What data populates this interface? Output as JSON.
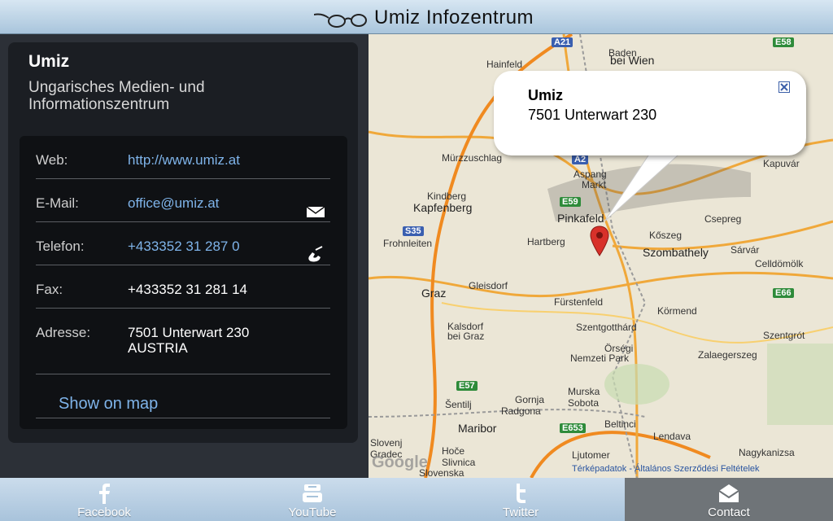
{
  "header": {
    "title": "Umiz  Infozentrum",
    "logo_icon": "glasses-icon"
  },
  "contact": {
    "name": "Umiz",
    "subtitle": "Ungarisches Medien- und Informationszentrum",
    "rows": [
      {
        "label": "Web:",
        "value": "http://www.umiz.at",
        "link": true
      },
      {
        "label": "E-Mail:",
        "value": "office@umiz.at",
        "link": true,
        "icon": "envelope-icon"
      },
      {
        "label": "Telefon:",
        "value": "+433352 31 287 0",
        "link": true,
        "icon": "phone-icon"
      },
      {
        "label": "Fax:",
        "value": "+433352 31 281 14",
        "link": false
      },
      {
        "label": "Adresse:",
        "value": "7501 Unterwart 230",
        "value2": "AUSTRIA",
        "link": false
      }
    ],
    "show_on_map": "Show on map"
  },
  "map": {
    "popup": {
      "name": "Umiz",
      "address": "7501 Unterwart 230"
    },
    "labels": [
      "Hainfeld",
      "Baden",
      "bei Wien",
      "Mürzzuschlag",
      "Aspang",
      "Markt",
      "Kindberg",
      "Kapfenberg",
      "Pinkafeld",
      "Frohnleiten",
      "Hartberg",
      "Kőszeg",
      "Szombathely",
      "Csepreg",
      "Sárvár",
      "Celldömölk",
      "Graz",
      "Gleisdorf",
      "Fürstenfeld",
      "Körmend",
      "Kalsdorf",
      "bei Graz",
      "Szentgotthárd",
      "Szentgrót",
      "Örségi",
      "Nemzeti Park",
      "Zalaegerszeg",
      "Gornja",
      "Radgona",
      "Murska",
      "Sobota",
      "Šentilj",
      "Maribor",
      "Beltinci",
      "Lendava",
      "Slovenj",
      "Gradec",
      "Hoče",
      "Slivnica",
      "Ljutomer",
      "Slovenska",
      "Kapuvár",
      "Nagykanizsa"
    ],
    "roads": [
      "A21",
      "E58",
      "A2",
      "E59",
      "S35",
      "E66",
      "E57",
      "E653"
    ],
    "google_label": "Google",
    "terms": "Térképadatok - Általános Szerződési Feltételek"
  },
  "tabs": [
    {
      "label": "Facebook",
      "icon": "facebook-icon"
    },
    {
      "label": "YouTube",
      "icon": "youtube-icon"
    },
    {
      "label": "Twitter",
      "icon": "twitter-icon"
    },
    {
      "label": "Contact",
      "icon": "envelope-icon",
      "active": true
    }
  ],
  "colors": {
    "link": "#7fb4ea",
    "tab_active": "#6f7478",
    "pin": "#d8312a"
  }
}
